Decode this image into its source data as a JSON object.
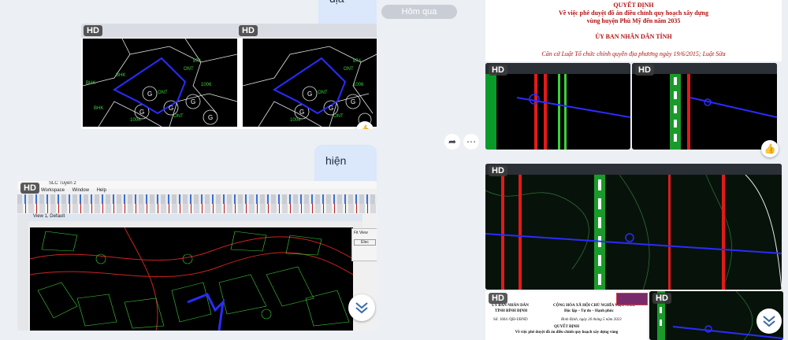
{
  "left_chat": {
    "top_bubble_text": "địa chính",
    "mid_bubble_text": "hiện trạng",
    "hd_label": "HD",
    "microstation": {
      "title": "SLC Tuyền 2",
      "menus": [
        "Workspace",
        "Window",
        "Help"
      ],
      "view_title": "View 1, Default",
      "side_panel_title": "Fit View",
      "side_panel_button": "Elec"
    },
    "cad_labels_left": [
      "BHK",
      "BHK",
      "BHK",
      "ONT",
      "ONT",
      "ONT",
      "G",
      "G",
      "G",
      "G",
      "G",
      "1004",
      "1006",
      "874",
      "874"
    ],
    "cad_labels_right": [
      "ONT",
      "ONT",
      "ONT",
      "G",
      "G",
      "G",
      "G",
      "1004",
      "1005",
      "874",
      "1006"
    ]
  },
  "middle_chat": {
    "date_pill": "Hôm qua"
  },
  "right_chat": {
    "hd_label": "HD",
    "decision_doc": {
      "title": "QUYẾT ĐỊNH",
      "line1": "Về việc phê duyệt đồ án điều chỉnh quy hoạch xây dựng",
      "line2": "vùng huyện Phù Mỹ đến năm 2035",
      "committee": "ỦY BAN NHÂN DÂN TỈNH",
      "basis": "Căn cứ Luật Tổ chức chính quyền địa phương ngày 19/6/2015; Luật Sửa"
    },
    "bottom_doc": {
      "left_head1": "ỦY BAN NHÂN DÂN",
      "left_head2": "TỈNH BÌNH ĐỊNH",
      "number": "Số: 1604 /QĐ-UBND",
      "right_head1": "CỘNG HÒA XÃ HỘI CHỦ NGHĨA VIỆT NAM",
      "right_head2": "Độc lập – Tự do – Hạnh phúc",
      "date": "Bình Định, ngày 26 tháng 5 năm 2023",
      "title": "QUYẾT ĐỊNH",
      "subtitle": "Về việc phê duyệt đồ án điều chỉnh quy hoạch xây dựng vùng"
    }
  },
  "colors": {
    "page_bg": "#eceff3",
    "bubble_bg": "#dbe7fb",
    "cad_bg": "#000000",
    "cad_green": "#3ad13a",
    "cad_blue": "#1515ff",
    "cad_red": "#e11a1a"
  }
}
